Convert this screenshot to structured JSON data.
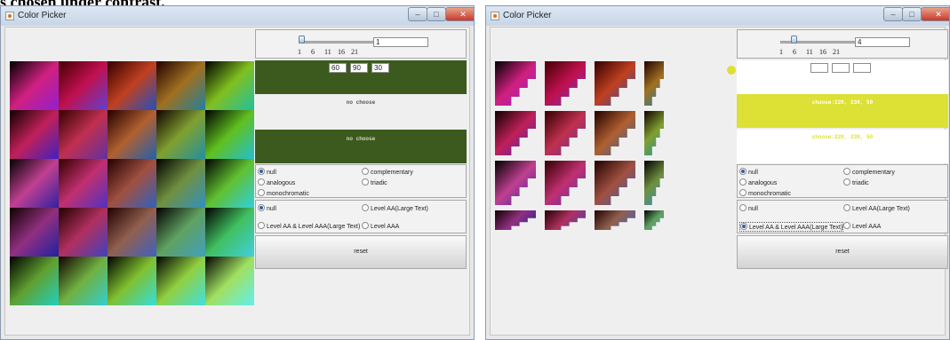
{
  "caption": "s chosen under contrast.",
  "left_window": {
    "title": "Color Picker",
    "slider": {
      "ticks": [
        "1",
        "6",
        "11",
        "16",
        "21"
      ],
      "value_field": "1",
      "level": 0
    },
    "rgb_fields": [
      "60",
      "90",
      "30"
    ],
    "base_color": "#3c5a1e",
    "label_1": "no choose",
    "label_2": "no choose",
    "scheme_options": [
      "null",
      "complementary",
      "analogous",
      "triadic",
      "monochromatic"
    ],
    "scheme_selected": "null",
    "level_options": [
      "null",
      "Level AA(Large Text)",
      "Level AA & Level AAA(Large Text)",
      "Level AAA"
    ],
    "level_selected": "null",
    "reset_label": "reset"
  },
  "right_window": {
    "title": "Color Picker",
    "slider": {
      "ticks": [
        "1",
        "6",
        "11",
        "16",
        "21"
      ],
      "value_field": "4",
      "level": 0.15
    },
    "rgb_fields": [
      "",
      "",
      ""
    ],
    "chosen_color": "#dde035",
    "label_1": "choose:220, 230, 50",
    "label_2": "choose:220, 230, 50",
    "scheme_options": [
      "null",
      "complementary",
      "analogous",
      "triadic",
      "monochromatic"
    ],
    "scheme_selected": "null",
    "level_options": [
      "null",
      "Level AA(Large Text)",
      "Level AA & Level AAA(Large Text)",
      "Level AAA"
    ],
    "level_selected": "Level AA & Level AAA(Large Text)",
    "reset_label": "reset"
  },
  "icons": {
    "minimize": "minimize-icon",
    "maximize": "maximize-icon",
    "close": "close-icon",
    "app": "java-app-icon"
  },
  "colors": {
    "titlebar": "#cfdcea",
    "close": "#c8392a",
    "panel_green": "#3c5a1e",
    "chosen_yellow": "#dde035"
  }
}
